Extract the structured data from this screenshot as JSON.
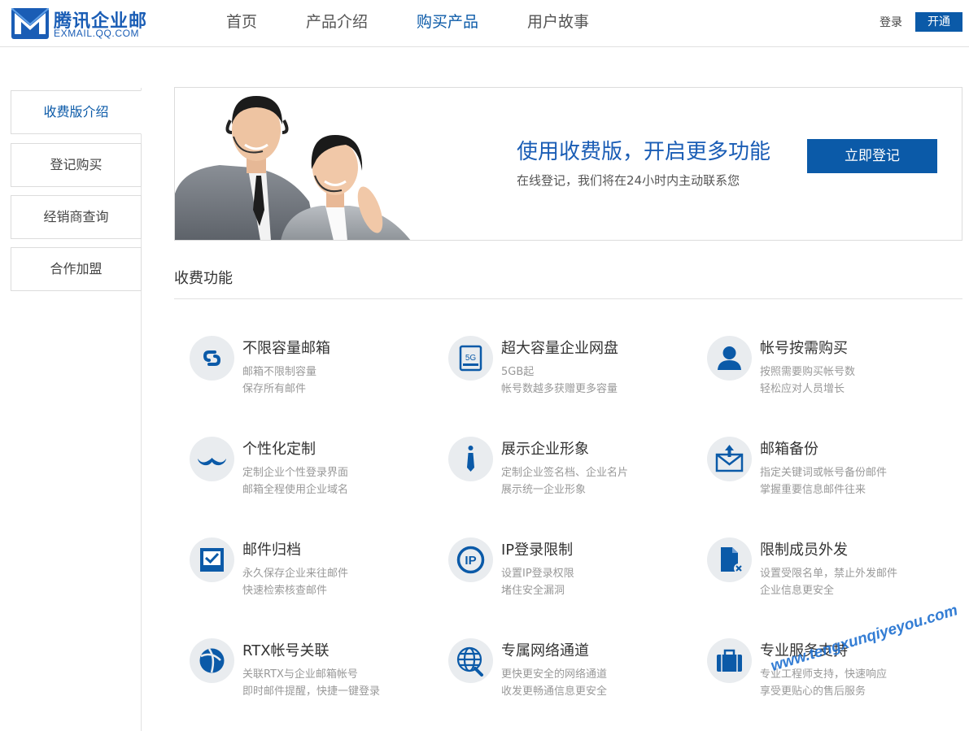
{
  "header": {
    "logo_title": "腾讯企业邮",
    "logo_sub": "EXMAIL.QQ.COM",
    "nav": [
      {
        "label": "首页"
      },
      {
        "label": "产品介绍"
      },
      {
        "label": "购买产品"
      },
      {
        "label": "用户故事"
      }
    ],
    "active_nav": "购买产品",
    "login": "登录",
    "open": "开通"
  },
  "sidebar": {
    "items": [
      {
        "label": "收费版介绍"
      },
      {
        "label": "登记购买"
      },
      {
        "label": "经销商查询"
      },
      {
        "label": "合作加盟"
      }
    ],
    "active": "收费版介绍"
  },
  "banner": {
    "title": "使用收费版，开启更多功能",
    "subtitle": "在线登记，我们将在24小时内主动联系您",
    "button": "立即登记"
  },
  "section": {
    "title": "收费功能"
  },
  "features": [
    {
      "icon": "link-icon",
      "title": "不限容量邮箱",
      "desc1": "邮箱不限制容量",
      "desc2": "保存所有邮件"
    },
    {
      "icon": "disk-5g-icon",
      "icon_text": "5G",
      "title": "超大容量企业网盘",
      "desc1": "5GB起",
      "desc2": "帐号数越多获赠更多容量"
    },
    {
      "icon": "user-icon",
      "title": "帐号按需购买",
      "desc1": "按照需要购买帐号数",
      "desc2": "轻松应对人员增长"
    },
    {
      "icon": "mustache-icon",
      "title": "个性化定制",
      "desc1": "定制企业个性登录界面",
      "desc2": "邮箱全程使用企业域名"
    },
    {
      "icon": "tie-icon",
      "title": "展示企业形象",
      "desc1": "定制企业签名档、企业名片",
      "desc2": "展示统一企业形象"
    },
    {
      "icon": "mail-backup-icon",
      "title": "邮箱备份",
      "desc1": "指定关键词或帐号备份邮件",
      "desc2": "掌握重要信息邮件往来"
    },
    {
      "icon": "archive-icon",
      "title": "邮件归档",
      "desc1": "永久保存企业来往邮件",
      "desc2": "快速检索核查邮件"
    },
    {
      "icon": "ip-icon",
      "icon_text": "IP",
      "title": "IP登录限制",
      "desc1": "设置IP登录权限",
      "desc2": "堵住安全漏洞"
    },
    {
      "icon": "file-block-icon",
      "title": "限制成员外发",
      "desc1": "设置受限名单，禁止外发邮件",
      "desc2": "企业信息更安全"
    },
    {
      "icon": "rtx-icon",
      "title": "RTX帐号关联",
      "desc1": "关联RTX与企业邮箱帐号",
      "desc2": "即时邮件提醒，快捷一键登录"
    },
    {
      "icon": "globe-wrench-icon",
      "title": "专属网络通道",
      "desc1": "更快更安全的网络通道",
      "desc2": "收发更畅通信息更安全"
    },
    {
      "icon": "briefcase-icon",
      "title": "专业服务支持",
      "desc1": "专业工程师支持，快速响应",
      "desc2": "享受更贴心的售后服务"
    }
  ],
  "watermark": "www.tengxunqiyeyou.com",
  "colors": {
    "brand": "#0b5aa8",
    "icon_bg": "#e9ecef",
    "text_muted": "#999999"
  }
}
